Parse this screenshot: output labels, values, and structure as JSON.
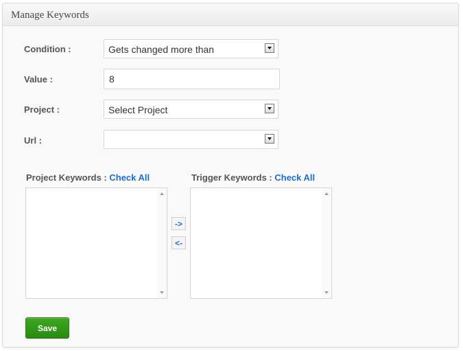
{
  "header": {
    "title": "Manage Keywords"
  },
  "form": {
    "condition": {
      "label": "Condition :",
      "selected": "Gets changed more than"
    },
    "value": {
      "label": "Value :",
      "input_value": "8"
    },
    "project": {
      "label": "Project :",
      "selected": "Select Project"
    },
    "url": {
      "label": "Url :",
      "selected": ""
    }
  },
  "keywords": {
    "project_label": "Project Keywords : ",
    "trigger_label": "Trigger Keywords : ",
    "check_all": "Check All",
    "move_right": "->",
    "move_left": "<-"
  },
  "actions": {
    "save_label": "Save"
  },
  "colors": {
    "link": "#1a6fd1",
    "save_button": "#2e9417"
  },
  "icons": {
    "dropdown": "chevron-down-icon",
    "scroll_up": "scroll-up-icon",
    "scroll_down": "scroll-down-icon"
  }
}
